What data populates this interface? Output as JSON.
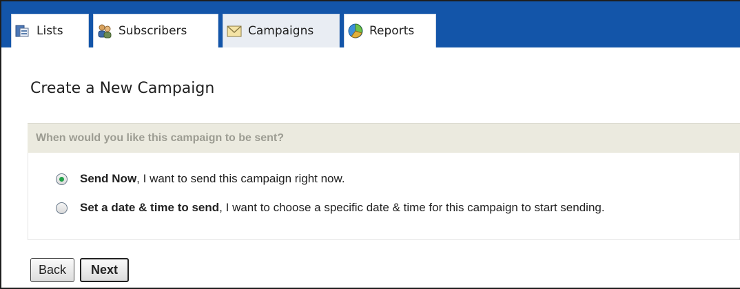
{
  "tabs": [
    {
      "label": "Lists",
      "icon": "lists-icon"
    },
    {
      "label": "Subscribers",
      "icon": "subscribers-icon"
    },
    {
      "label": "Campaigns",
      "icon": "campaigns-icon"
    },
    {
      "label": "Reports",
      "icon": "reports-icon"
    }
  ],
  "active_tab": "Campaigns",
  "page": {
    "title": "Create a New Campaign",
    "question": "When would you like this campaign to be sent?"
  },
  "options": [
    {
      "label": "Send Now",
      "description": " , I want to send this campaign right now.",
      "selected": true
    },
    {
      "label": "Set a date & time to send",
      "description": " , I want to choose a specific date & time for this campaign to start sending.",
      "selected": false
    }
  ],
  "buttons": {
    "back": "Back",
    "next": "Next"
  },
  "colors": {
    "tabbar": "#1355a9",
    "question_bg": "#ebeadf",
    "radio_selected": "#23a14a"
  }
}
